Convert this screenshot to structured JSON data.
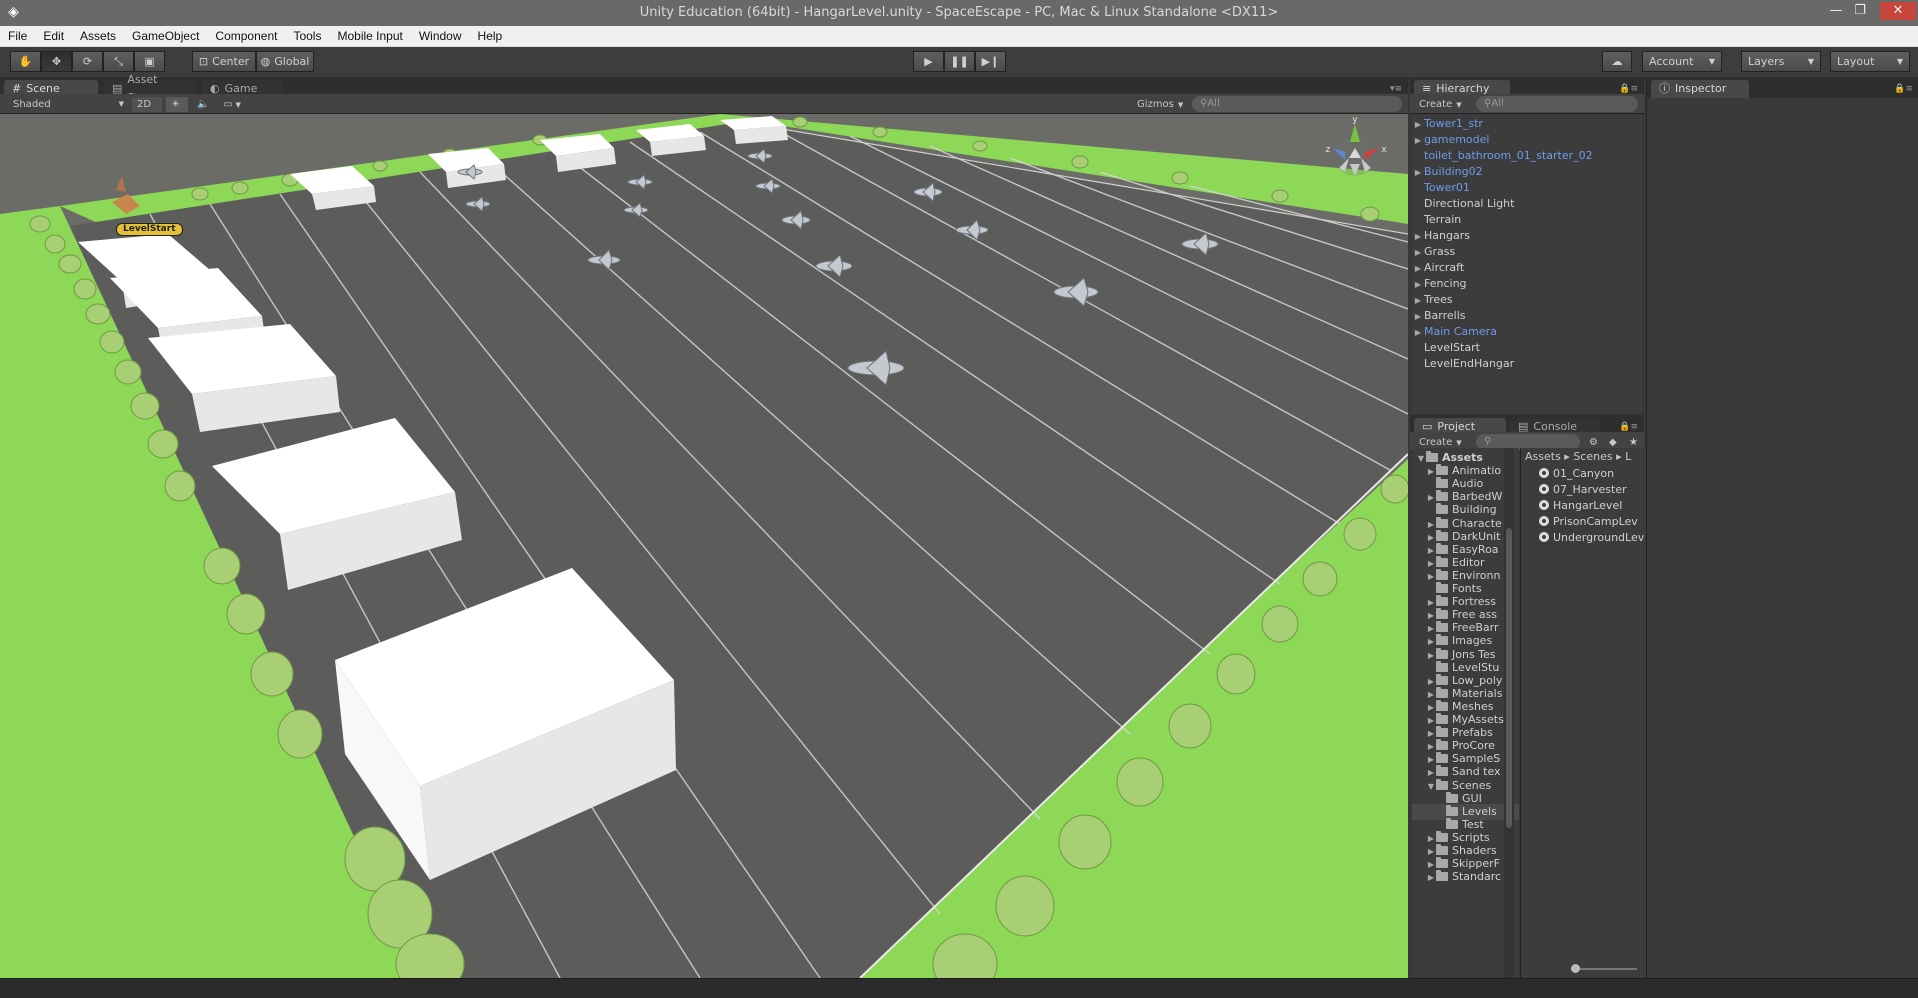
{
  "window": {
    "title": "Unity Education (64bit) - HangarLevel.unity - SpaceEscape - PC, Mac & Linux Standalone <DX11>",
    "minimize": "—",
    "restore": "❐",
    "close": "✕"
  },
  "menu": [
    "File",
    "Edit",
    "Assets",
    "GameObject",
    "Component",
    "Tools",
    "Mobile Input",
    "Window",
    "Help"
  ],
  "toolbar": {
    "pivot_label": "Center",
    "space_label": "Global",
    "account_label": "Account",
    "layers_label": "Layers",
    "layout_label": "Layout"
  },
  "scene_panel": {
    "tabs": [
      "Scene",
      "Asset Store",
      "Game"
    ],
    "shading_mode": "Shaded",
    "mode_2d": "2D",
    "gizmos_label": "Gizmos",
    "search_placeholder": "All",
    "level_start_label": "LevelStart",
    "gizmo_axis_y": "y",
    "gizmo_axis_x": "x",
    "gizmo_axis_z": "z"
  },
  "hierarchy": {
    "tab": "Hierarchy",
    "create_label": "Create",
    "search_placeholder": "All",
    "items": [
      {
        "label": "Tower1_str",
        "arrow": "▶",
        "color": "blue"
      },
      {
        "label": "gamemodel",
        "arrow": "▶",
        "color": "blue"
      },
      {
        "label": "toilet_bathroom_01_starter_02",
        "arrow": "",
        "color": "blue"
      },
      {
        "label": "Building02",
        "arrow": "▶",
        "color": "blue"
      },
      {
        "label": "Tower01",
        "arrow": "",
        "color": "blue"
      },
      {
        "label": "Directional Light",
        "arrow": "",
        "color": "normal"
      },
      {
        "label": "Terrain",
        "arrow": "",
        "color": "normal"
      },
      {
        "label": "Hangars",
        "arrow": "▶",
        "color": "normal"
      },
      {
        "label": "Grass",
        "arrow": "▶",
        "color": "normal"
      },
      {
        "label": "Aircraft",
        "arrow": "▶",
        "color": "normal"
      },
      {
        "label": "Fencing",
        "arrow": "▶",
        "color": "normal"
      },
      {
        "label": "Trees",
        "arrow": "▶",
        "color": "normal"
      },
      {
        "label": "Barrells",
        "arrow": "▶",
        "color": "normal"
      },
      {
        "label": "Main Camera",
        "arrow": "▶",
        "color": "blue"
      },
      {
        "label": "LevelStart",
        "arrow": "",
        "color": "normal"
      },
      {
        "label": "LevelEndHangar",
        "arrow": "",
        "color": "normal"
      }
    ]
  },
  "inspector": {
    "tab": "Inspector"
  },
  "project": {
    "tabs": [
      "Project",
      "Console"
    ],
    "create_label": "Create",
    "tree": [
      {
        "label": "Assets",
        "arrow": "▼",
        "indent": 0,
        "bold": true
      },
      {
        "label": "Animatio",
        "arrow": "▶",
        "indent": 1
      },
      {
        "label": "Audio",
        "arrow": "",
        "indent": 1
      },
      {
        "label": "BarbedW",
        "arrow": "▶",
        "indent": 1
      },
      {
        "label": "Building",
        "arrow": "",
        "indent": 1
      },
      {
        "label": "Characte",
        "arrow": "▶",
        "indent": 1
      },
      {
        "label": "DarkUnit",
        "arrow": "▶",
        "indent": 1
      },
      {
        "label": "EasyRoa",
        "arrow": "▶",
        "indent": 1
      },
      {
        "label": "Editor",
        "arrow": "▶",
        "indent": 1
      },
      {
        "label": "Environn",
        "arrow": "▶",
        "indent": 1
      },
      {
        "label": "Fonts",
        "arrow": "",
        "indent": 1
      },
      {
        "label": "Fortress",
        "arrow": "▶",
        "indent": 1
      },
      {
        "label": "Free ass",
        "arrow": "▶",
        "indent": 1
      },
      {
        "label": "FreeBarr",
        "arrow": "▶",
        "indent": 1
      },
      {
        "label": "Images",
        "arrow": "▶",
        "indent": 1
      },
      {
        "label": "Jons Tes",
        "arrow": "▶",
        "indent": 1
      },
      {
        "label": "LevelStu",
        "arrow": "",
        "indent": 1
      },
      {
        "label": "Low_poly",
        "arrow": "▶",
        "indent": 1
      },
      {
        "label": "Materials",
        "arrow": "▶",
        "indent": 1
      },
      {
        "label": "Meshes",
        "arrow": "▶",
        "indent": 1
      },
      {
        "label": "MyAssets",
        "arrow": "▶",
        "indent": 1
      },
      {
        "label": "Prefabs",
        "arrow": "▶",
        "indent": 1
      },
      {
        "label": "ProCore",
        "arrow": "▶",
        "indent": 1
      },
      {
        "label": "SampleS",
        "arrow": "▶",
        "indent": 1
      },
      {
        "label": "Sand tex",
        "arrow": "▶",
        "indent": 1
      },
      {
        "label": "Scenes",
        "arrow": "▼",
        "indent": 1
      },
      {
        "label": "GUI",
        "arrow": "",
        "indent": 2
      },
      {
        "label": "Levels",
        "arrow": "",
        "indent": 2,
        "selected": true
      },
      {
        "label": "Test",
        "arrow": "",
        "indent": 2
      },
      {
        "label": "Scripts",
        "arrow": "▶",
        "indent": 1
      },
      {
        "label": "Shaders",
        "arrow": "▶",
        "indent": 1
      },
      {
        "label": "SkipperF",
        "arrow": "▶",
        "indent": 1
      },
      {
        "label": "Standarc",
        "arrow": "▶",
        "indent": 1
      }
    ],
    "breadcrumb": "Assets ▸ Scenes ▸ L",
    "scenes": [
      "01_Canyon",
      "07_Harvester",
      "HangarLevel",
      "PrisonCampLev",
      "UndergroundLev"
    ]
  },
  "colors": {
    "grass": "#8ed858",
    "runway": "#5a5b58",
    "hangar": "#f2f4f4",
    "selection_blue": "#6f9be8"
  }
}
